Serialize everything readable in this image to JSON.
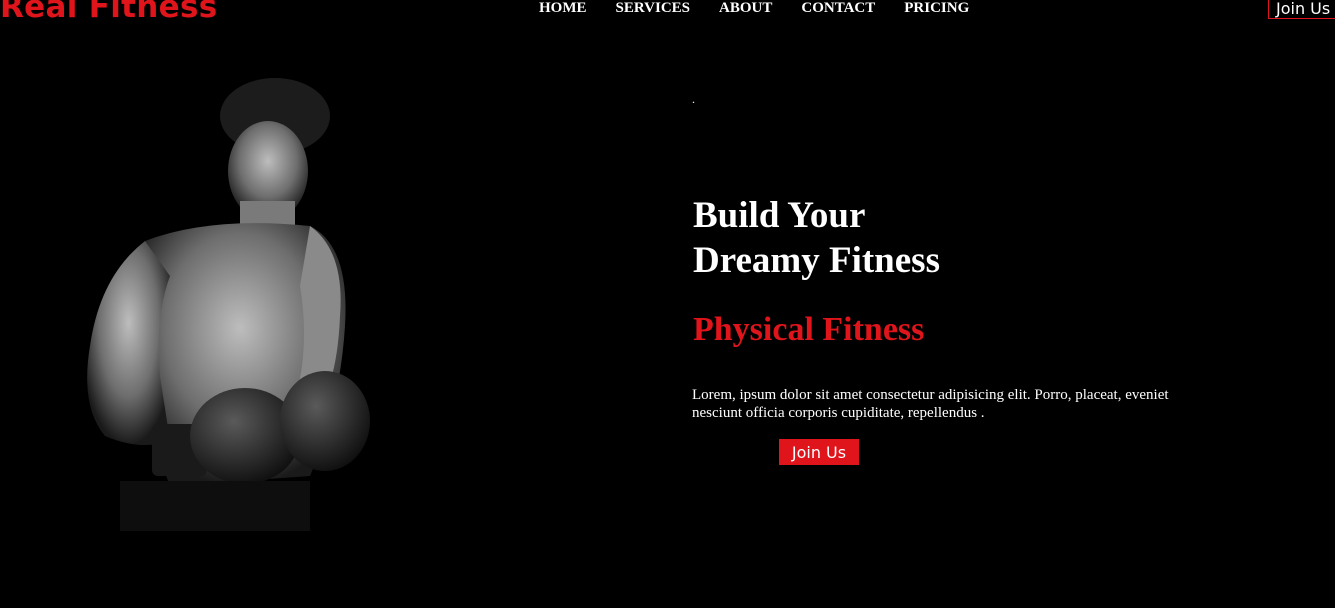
{
  "brand": {
    "name": "Real Fitness",
    "accent_color": "#e0141b"
  },
  "nav": {
    "items": [
      {
        "label": "HOME"
      },
      {
        "label": "SERVICES"
      },
      {
        "label": "ABOUT"
      },
      {
        "label": "CONTACT"
      },
      {
        "label": "PRICING"
      }
    ]
  },
  "header": {
    "join_label": "Join Us"
  },
  "hero": {
    "image_icon": "boxer-photo",
    "dot": ".",
    "headline_line1": "Build Your",
    "headline_line2": "Dreamy Fitness",
    "subheadline": "Physical Fitness",
    "description": "Lorem, ipsum dolor sit amet consectetur adipisicing elit. Porro, placeat, eveniet nesciunt officia corporis cupiditate, repellendus .",
    "cta_label": "Join Us"
  }
}
